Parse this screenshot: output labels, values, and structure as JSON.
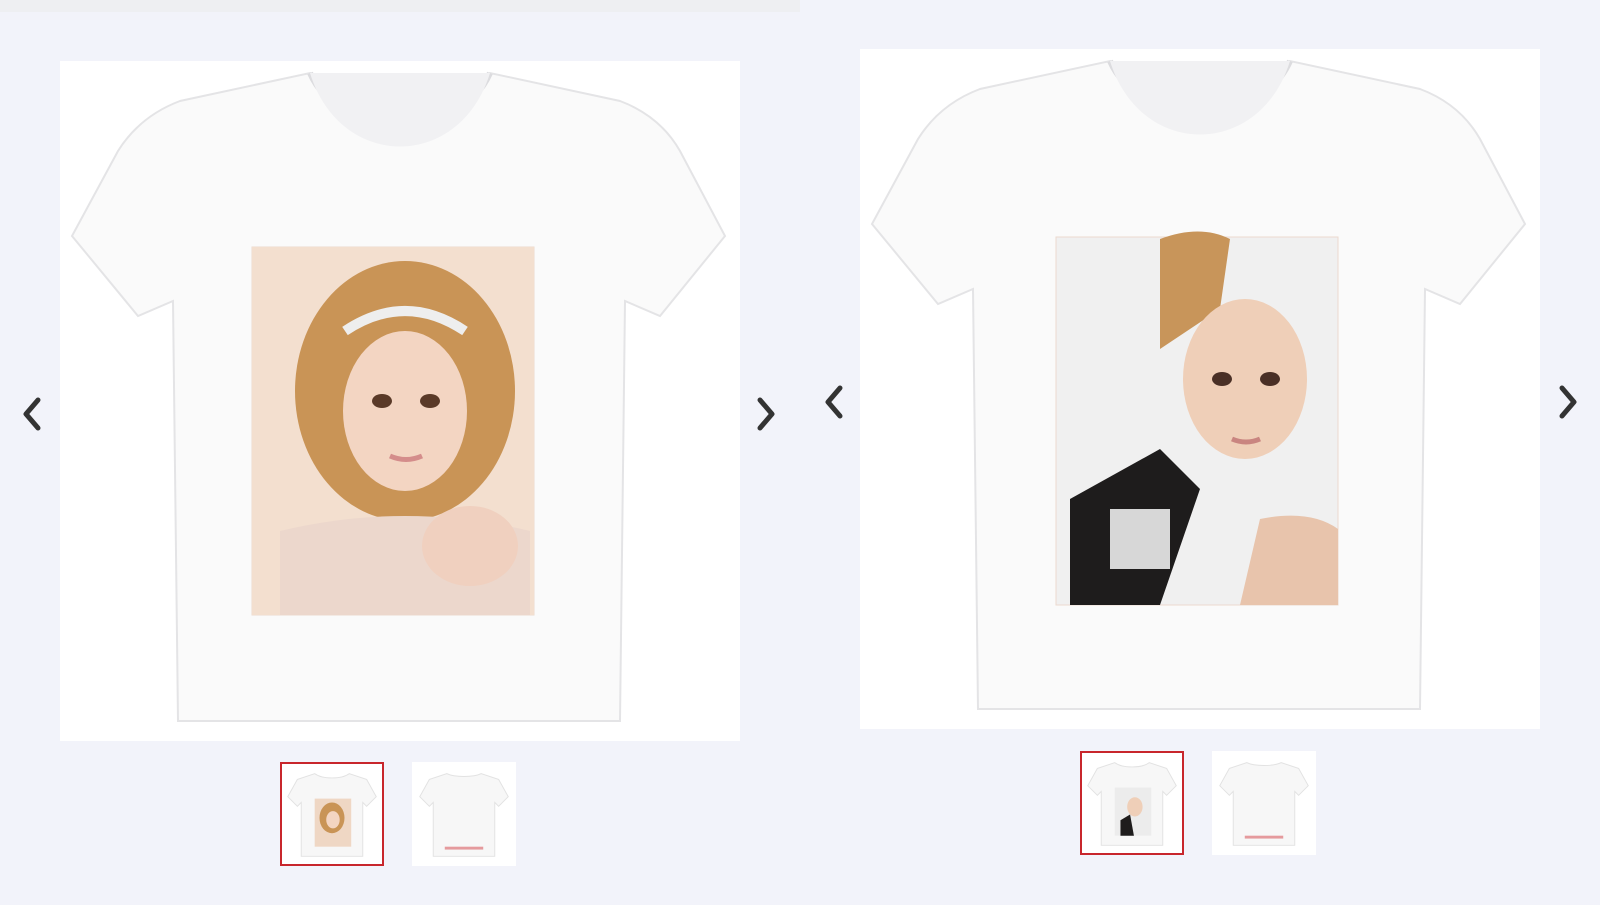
{
  "theme": {
    "background": "#f2f3fa",
    "active_thumb_border": "#c8262c",
    "arrow_color": "#333333"
  },
  "galleries": [
    {
      "main_image": "white-tshirt-portrait-tiara",
      "nav": {
        "prev_icon": "chevron-left-icon",
        "next_icon": "chevron-right-icon"
      },
      "thumbnails": [
        {
          "image": "front-view",
          "active": true
        },
        {
          "image": "back-view",
          "active": false
        }
      ]
    },
    {
      "main_image": "white-tshirt-portrait-ponytail",
      "nav": {
        "prev_icon": "chevron-left-icon",
        "next_icon": "chevron-right-icon"
      },
      "thumbnails": [
        {
          "image": "front-view",
          "active": true
        },
        {
          "image": "back-view",
          "active": false
        }
      ]
    }
  ]
}
